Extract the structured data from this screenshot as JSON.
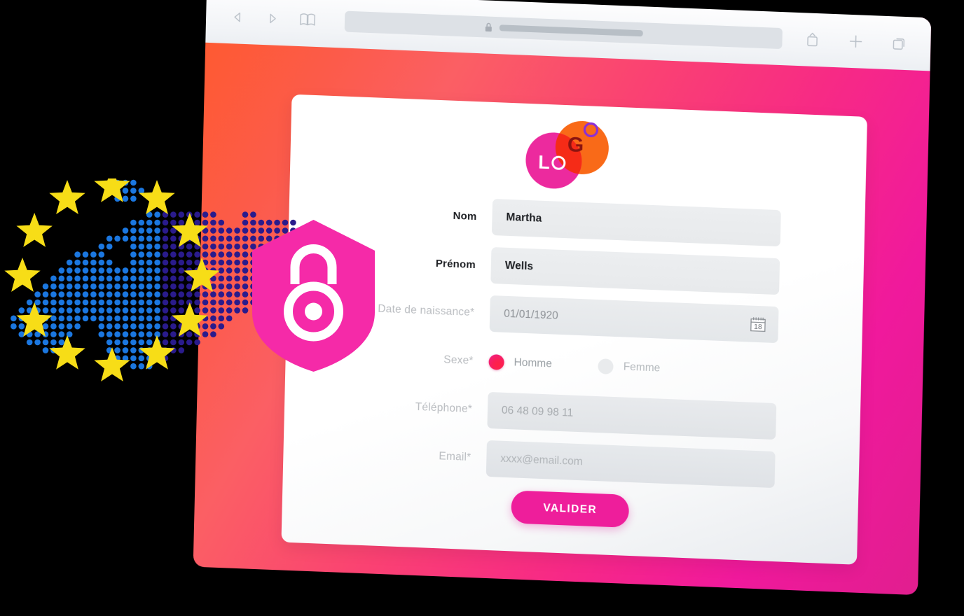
{
  "browser": {
    "toolbar": {
      "back_icon": "back-arrow-icon",
      "forward_icon": "forward-arrow-icon",
      "bookmarks_icon": "book-icon",
      "share_icon": "share-icon",
      "new_tab_icon": "plus-icon",
      "tabs_icon": "tabs-icon"
    },
    "address_bar": {
      "lock_icon": "lock-icon",
      "url_text": "",
      "placeholder": ""
    }
  },
  "page": {
    "logo": {
      "circle_left_text": "LO",
      "circle_right_text": "GO",
      "left_letter": "L",
      "left_ring": "O",
      "right_letter": "G",
      "right_ring": "O",
      "pink": "#ec2a9e",
      "orange": "#f96a18",
      "overlap": "#f52b17",
      "ring_purple": "#8b2fd6",
      "g_color": "#8c1410"
    },
    "form": {
      "rows": [
        {
          "label": "Nom",
          "value": "Martha",
          "type": "text",
          "strong": true
        },
        {
          "label": "Prénom",
          "value": "Wells",
          "type": "text",
          "strong": true
        },
        {
          "label": "Date de naissance*",
          "value": "01/01/1920",
          "type": "date",
          "strong": false
        },
        {
          "label": "Sexe*",
          "value": "",
          "type": "radio",
          "strong": false
        },
        {
          "label": "Téléphone*",
          "value": "06 48 09 98 11",
          "type": "text",
          "strong": false
        },
        {
          "label": "Email*",
          "value": "xxxx@email.com",
          "type": "text",
          "strong": false
        }
      ],
      "radios": [
        {
          "label": "Homme",
          "selected": true
        },
        {
          "label": "Femme",
          "selected": false
        }
      ],
      "calendar_icon": {
        "name": "calendar-icon",
        "day": "18"
      },
      "submit_label": "VALIDER"
    }
  },
  "decorations": {
    "eu_stars": {
      "count": 12,
      "color": "#f7dd17",
      "name": "eu-flag-stars"
    },
    "dot_map": {
      "name": "europe-dot-map",
      "dot_color": "#1b77e0",
      "dot_color_overlap": "#2a1b8c"
    },
    "shield": {
      "name": "security-shield-padlock",
      "color": "#f52aa8",
      "lock_color": "#ffffff"
    }
  },
  "colors": {
    "bg_gradient_start": "#ff5a2d",
    "bg_gradient_mid": "#fa4272",
    "bg_gradient_end": "#f0199c",
    "accent": "#ee1e9b",
    "card_bg": "#ffffff",
    "field_bg": "#eceef0",
    "stage_bg": "#000000"
  }
}
